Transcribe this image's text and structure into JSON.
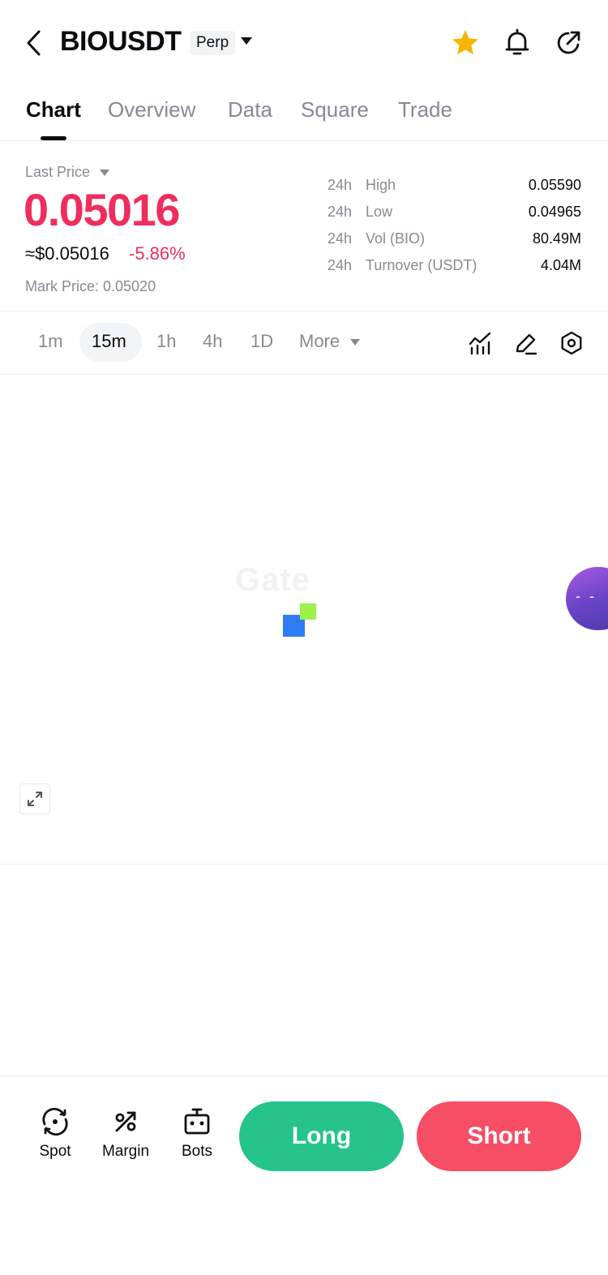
{
  "header": {
    "symbol": "BIOUSDT",
    "badge": "Perp",
    "icons": [
      "back-icon",
      "star-icon",
      "bell-icon",
      "share-icon"
    ],
    "star_color": "#f7b500"
  },
  "tabs": [
    {
      "label": "Chart",
      "active": true
    },
    {
      "label": "Overview"
    },
    {
      "label": "Data"
    },
    {
      "label": "Square"
    },
    {
      "label": "Trade"
    }
  ],
  "price": {
    "last_price_label": "Last Price",
    "last_price": "0.05016",
    "usd_price": "≈$0.05016",
    "change_pct": "-5.86%",
    "mark_price": "Mark Price: 0.05020",
    "down_color": "#ee2e5e"
  },
  "stats": [
    {
      "period": "24h",
      "name": "High",
      "value": "0.05590"
    },
    {
      "period": "24h",
      "name": "Low",
      "value": "0.04965"
    },
    {
      "period": "24h",
      "name": "Vol (BIO)",
      "value": "80.49M"
    },
    {
      "period": "24h",
      "name": "Turnover (USDT)",
      "value": "4.04M"
    }
  ],
  "intervals": {
    "items": [
      "1m",
      "15m",
      "1h",
      "4h",
      "1D"
    ],
    "active": "15m",
    "more": "More",
    "tools": [
      "indicator-icon",
      "draw-icon",
      "settings-icon"
    ]
  },
  "chart": {
    "watermark": "Gate",
    "bubble_text": "- -"
  },
  "bottom": {
    "spot": "Spot",
    "margin": "Margin",
    "bots": "Bots",
    "long": "Long",
    "short": "Short",
    "long_color": "#26c48b",
    "short_color": "#f54e65"
  }
}
